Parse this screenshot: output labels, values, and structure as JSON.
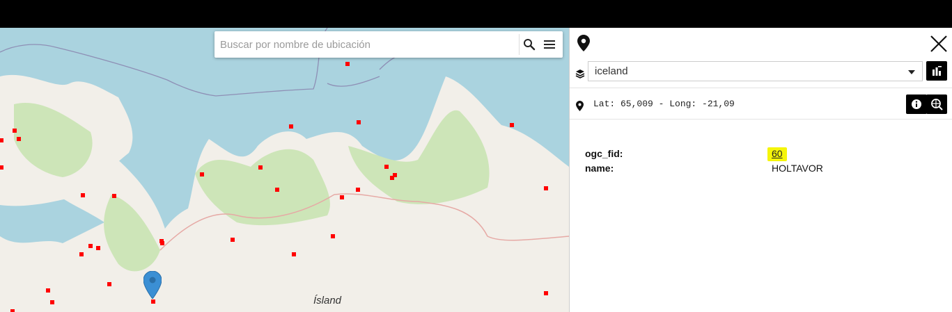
{
  "search": {
    "placeholder": "Buscar por nombre de ubicación"
  },
  "map": {
    "place_label": "Ísland"
  },
  "panel": {
    "layer": "iceland",
    "coordinates": "Lat: 65,009 - Long: -21,09",
    "attributes": [
      {
        "key": "ogc_fid:",
        "value": "60"
      },
      {
        "key": "name:",
        "value": "HOLTAVOR"
      }
    ]
  },
  "icons": [
    "search-icon",
    "menu-icon",
    "location-pin-icon",
    "close-icon",
    "layers-icon",
    "chart-icon",
    "info-icon",
    "zoom-to-icon",
    "marker-icon"
  ],
  "colors": {
    "accent": "#000000",
    "highlight": "#f5f50a",
    "map_points": "#ff0000",
    "marker": "#3b8fd4"
  }
}
